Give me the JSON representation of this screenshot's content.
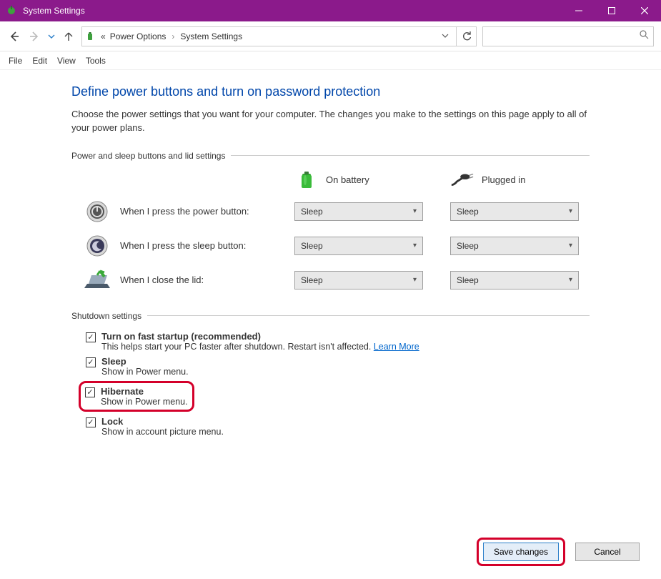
{
  "window": {
    "title": "System Settings"
  },
  "breadcrumb": {
    "prev": "Power Options",
    "current": "System Settings"
  },
  "menubar": {
    "file": "File",
    "edit": "Edit",
    "view": "View",
    "tools": "Tools"
  },
  "page": {
    "heading": "Define power buttons and turn on password protection",
    "description": "Choose the power settings that you want for your computer. The changes you make to the settings on this page apply to all of your power plans."
  },
  "section1_label": "Power and sleep buttons and lid settings",
  "columns": {
    "battery": "On battery",
    "plugged": "Plugged in"
  },
  "rows": {
    "power_btn": {
      "label": "When I press the power button:",
      "battery": "Sleep",
      "plugged": "Sleep"
    },
    "sleep_btn": {
      "label": "When I press the sleep button:",
      "battery": "Sleep",
      "plugged": "Sleep"
    },
    "lid": {
      "label": "When I close the lid:",
      "battery": "Sleep",
      "plugged": "Sleep"
    }
  },
  "section2_label": "Shutdown settings",
  "shutdown": {
    "fast": {
      "title": "Turn on fast startup (recommended)",
      "sub": "This helps start your PC faster after shutdown. Restart isn't affected. ",
      "link": "Learn More",
      "checked": true
    },
    "sleep": {
      "title": "Sleep",
      "sub": "Show in Power menu.",
      "checked": true
    },
    "hib": {
      "title": "Hibernate",
      "sub": "Show in Power menu.",
      "checked": true
    },
    "lock": {
      "title": "Lock",
      "sub": "Show in account picture menu.",
      "checked": true
    }
  },
  "buttons": {
    "save": "Save changes",
    "cancel": "Cancel"
  }
}
